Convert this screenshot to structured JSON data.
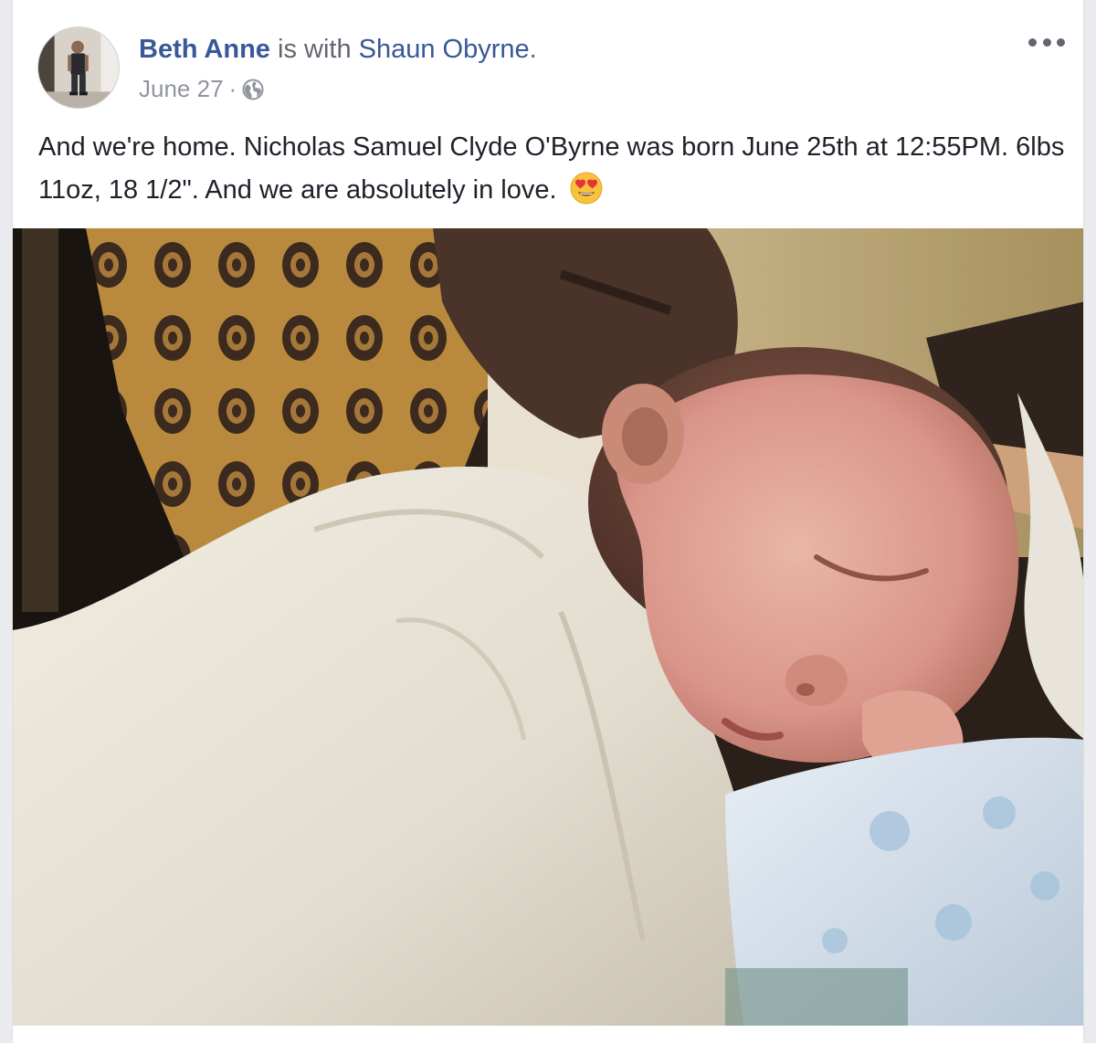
{
  "post": {
    "author": "Beth Anne",
    "with_text": " is with ",
    "tagged": "Shaun Obyrne",
    "period": ".",
    "date": "June 27",
    "separator": "·",
    "privacy_icon": "globe-icon",
    "more_icon": "more-options-icon",
    "text": "And we're home. Nicholas Samuel Clyde O'Byrne was born June 25th at 12:55PM. 6lbs 11oz, 18 1/2\". And we are absolutely in love.",
    "emoji": "heart-eyes-emoji",
    "photo": "photo-sleeping-newborn"
  },
  "colors": {
    "link": "#385898",
    "meta": "#90949c",
    "text": "#1d2129",
    "background": "#e9ebee"
  }
}
